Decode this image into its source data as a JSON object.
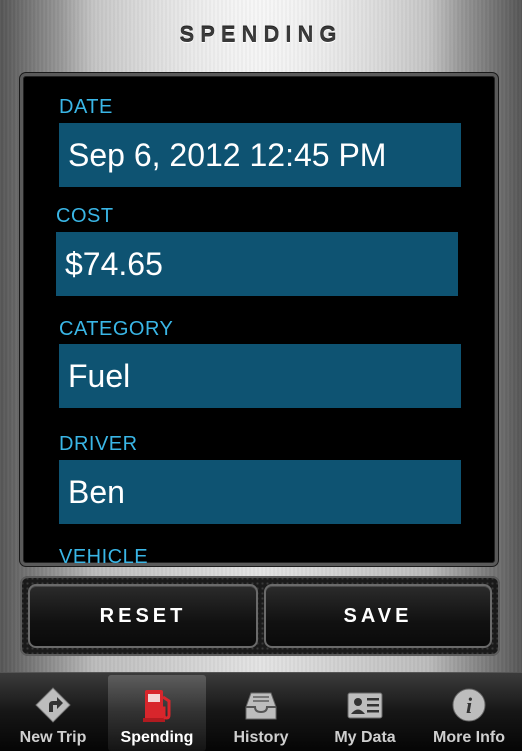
{
  "header": {
    "title": "SPENDING"
  },
  "form": {
    "date": {
      "label": "DATE",
      "value": "Sep 6, 2012 12:45 PM"
    },
    "cost": {
      "label": "COST",
      "value": "$74.65"
    },
    "category": {
      "label": "CATEGORY",
      "value": "Fuel"
    },
    "driver": {
      "label": "DRIVER",
      "value": "Ben"
    },
    "vehicle": {
      "label": "VEHICLE"
    }
  },
  "actions": {
    "reset_label": "RESET",
    "save_label": "SAVE"
  },
  "tabbar": {
    "tabs": [
      {
        "label": "New Trip",
        "icon": "turn-arrow-sign-icon"
      },
      {
        "label": "Spending",
        "icon": "fuel-pump-icon",
        "active": true
      },
      {
        "label": "History",
        "icon": "inbox-tray-icon"
      },
      {
        "label": "My Data",
        "icon": "id-card-icon"
      },
      {
        "label": "More Info",
        "icon": "info-icon"
      }
    ]
  },
  "colors": {
    "label_blue": "#3ab6e6",
    "field_bg": "#0e5372",
    "fuel_red": "#d8262c"
  }
}
